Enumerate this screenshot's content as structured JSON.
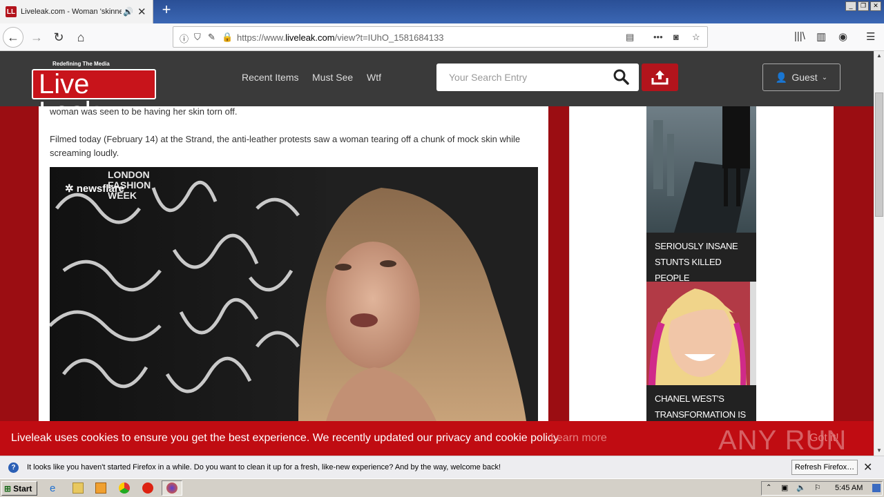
{
  "browser": {
    "tab": {
      "title": "Liveleak.com - Woman 'skinned'",
      "favicon": "LL"
    },
    "url": {
      "prefix": "https://www.",
      "domain": "liveleak.com",
      "path": "/view?t=IUhO_1581684133"
    }
  },
  "site": {
    "logo_tagline": "Redefining The Media",
    "logo_text_a": "Live",
    "logo_text_b": "Leak",
    "nav": [
      "Recent Items",
      "Must See",
      "Wtf"
    ],
    "search_placeholder": "Your Search Entry",
    "user_label": "Guest"
  },
  "article": {
    "para1": "woman was seen to be having her skin torn off.",
    "para2": "Filmed today (February 14) at the Strand, the anti-leather protests saw a woman tearing off a chunk of mock skin while screaming loudly.",
    "video_watermark": "newsflare",
    "backdrop_text": "LONDON\nFASHION\nWEEK"
  },
  "sidebar": {
    "cards": [
      {
        "caption": "SERIOUSLY INSANE STUNTS KILLED PEOPLE"
      },
      {
        "caption": "CHANEL WEST'S TRANSFORMATION IS"
      }
    ]
  },
  "cookie": {
    "text": "Liveleak uses cookies to ensure you get the best experience. We recently updated our privacy and cookie policy.",
    "learn_more": "Learn more",
    "got_it": "Got it!",
    "watermark": "ANY RUN"
  },
  "notification": {
    "text": "It looks like you haven't started Firefox in a while. Do you want to clean it up for a fresh, like-new experience? And by the way, welcome back!",
    "button": "Refresh Firefox…"
  },
  "taskbar": {
    "start": "Start",
    "clock": "5:45 AM"
  },
  "colors": {
    "brand_red": "#c8141b",
    "header_bg": "#3a3a3a",
    "page_bg": "#9b0d12"
  }
}
